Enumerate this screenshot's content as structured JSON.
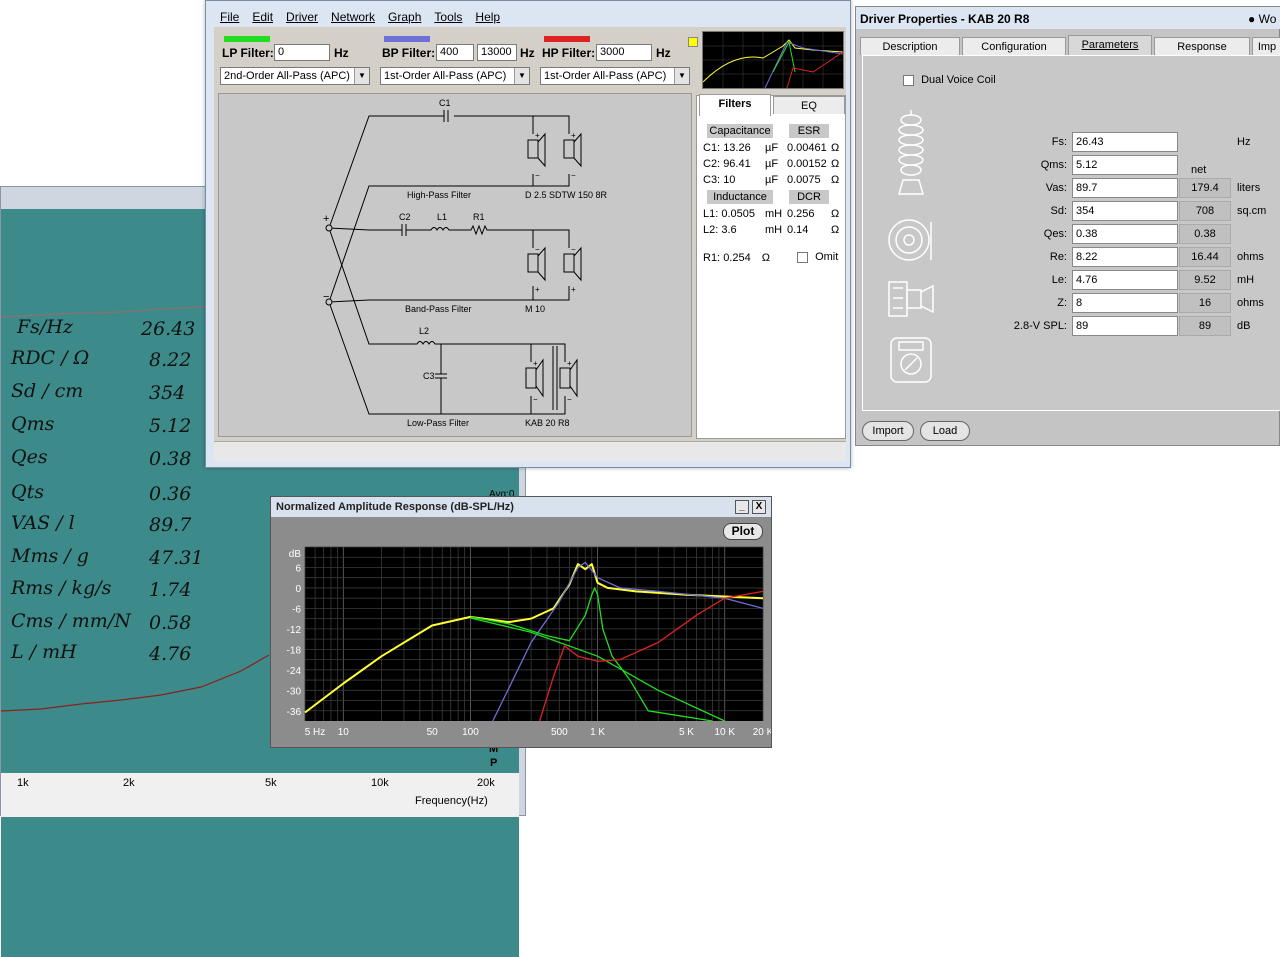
{
  "background_window": {
    "handwritten_params": [
      {
        "label": "Fs/Hz",
        "value": "26.43"
      },
      {
        "label": "RDC / Ω",
        "value": "8.22"
      },
      {
        "label": "Sd / cm",
        "value": "354"
      },
      {
        "label": "Qms",
        "value": "5.12"
      },
      {
        "label": "Qes",
        "value": "0.38"
      },
      {
        "label": "Qts",
        "value": "0.36"
      },
      {
        "label": "VAS / l",
        "value": "89.7"
      },
      {
        "label": "Mms / g",
        "value": "47.31"
      },
      {
        "label": "Rms / kg/s",
        "value": "1.74"
      },
      {
        "label": "Cms / mm/N",
        "value": "0.58"
      },
      {
        "label": "L / mH",
        "value": "4.76"
      }
    ],
    "x_ticks": [
      "1k",
      "2k",
      "5k",
      "10k",
      "20k"
    ],
    "x_axis_label": "Frequency(Hz)",
    "partial_label": "Avg:0",
    "side_letters": [
      "M",
      "P"
    ]
  },
  "crossover_window": {
    "menu": [
      "File",
      "Edit",
      "Driver",
      "Network",
      "Graph",
      "Tools",
      "Help"
    ],
    "lp": {
      "label": "LP Filter:",
      "value": "0",
      "unit": "Hz",
      "type": "2nd-Order All-Pass (APC)",
      "color": "#22dd22"
    },
    "bp": {
      "label": "BP Filter:",
      "value1": "400",
      "value2": "13000",
      "unit": "Hz",
      "type": "1st-Order All-Pass (APC)",
      "color": "#6f6fd8"
    },
    "hp": {
      "label": "HP Filter:",
      "value": "3000",
      "unit": "Hz",
      "type": "1st-Order All-Pass (APC)",
      "color": "#dd2222"
    },
    "schematic": {
      "labels": {
        "c1": "C1",
        "c2": "C2",
        "l1": "L1",
        "r1": "R1",
        "l2": "L2",
        "c3": "C3",
        "plus": "+",
        "minus": "−"
      },
      "sections": [
        {
          "filter": "High-Pass Filter",
          "driver": "D 2.5 SDTW 150 8R"
        },
        {
          "filter": "Band-Pass Filter",
          "driver": "M 10"
        },
        {
          "filter": "Low-Pass Filter",
          "driver": "KAB 20 R8"
        }
      ]
    },
    "tabs": [
      "Filters",
      "EQ"
    ],
    "capacitance_header": "Capacitance",
    "esr_header": "ESR",
    "capacitors": [
      {
        "name": "C1:",
        "value": "13.26",
        "unit": "µF",
        "esr": "0.00461",
        "esr_unit": "Ω"
      },
      {
        "name": "C2:",
        "value": "96.41",
        "unit": "µF",
        "esr": "0.00152",
        "esr_unit": "Ω"
      },
      {
        "name": "C3:",
        "value": "10",
        "unit": "µF",
        "esr": "0.0075",
        "esr_unit": "Ω"
      }
    ],
    "inductance_header": "Inductance",
    "dcr_header": "DCR",
    "inductors": [
      {
        "name": "L1:",
        "value": "0.0505",
        "unit": "mH",
        "dcr": "0.256",
        "dcr_unit": "Ω"
      },
      {
        "name": "L2:",
        "value": "3.6",
        "unit": "mH",
        "dcr": "0.14",
        "dcr_unit": "Ω"
      }
    ],
    "resistor": {
      "name": "R1:",
      "value": "0.254",
      "unit": "Ω",
      "omit_label": "Omit"
    }
  },
  "driver_window": {
    "title": "Driver Properties - KAB 20 R8",
    "radio_label": "Wo",
    "tabs": [
      "Description",
      "Configuration",
      "Parameters",
      "Response",
      "Imp"
    ],
    "active_tab": "Parameters",
    "dual_voice_coil": "Dual Voice Coil",
    "net_header": "net",
    "params": [
      {
        "label": "Fs:",
        "value": "26.43",
        "net": "",
        "unit": "Hz"
      },
      {
        "label": "Qms:",
        "value": "5.12",
        "net": "",
        "unit": ""
      },
      {
        "label": "Vas:",
        "value": "89.7",
        "net": "179.4",
        "unit": "liters"
      },
      {
        "label": "Sd:",
        "value": "354",
        "net": "708",
        "unit": "sq.cm"
      },
      {
        "label": "Qes:",
        "value": "0.38",
        "net": "0.38",
        "unit": ""
      },
      {
        "label": "Re:",
        "value": "8.22",
        "net": "16.44",
        "unit": "ohms"
      },
      {
        "label": "Le:",
        "value": "4.76",
        "net": "9.52",
        "unit": "mH"
      },
      {
        "label": "Z:",
        "value": "8",
        "net": "16",
        "unit": "ohms"
      },
      {
        "label": "2.8-V SPL:",
        "value": "89",
        "net": "89",
        "unit": "dB"
      }
    ],
    "buttons": {
      "import": "Import",
      "load": "Load"
    }
  },
  "amplitude_window": {
    "title": "Normalized Amplitude Response (dB-SPL/Hz)",
    "minimize_glyph": "_",
    "close_glyph": "X",
    "plot_button": "Plot"
  },
  "chart_data": {
    "type": "line",
    "title": "Normalized Amplitude Response (dB-SPL/Hz)",
    "xlabel": "",
    "ylabel": "dB",
    "x_scale": "log",
    "xlim": [
      5,
      20000
    ],
    "ylim": [
      -39,
      12
    ],
    "x_ticks": [
      5,
      10,
      50,
      100,
      500,
      1000,
      5000,
      10000,
      20000
    ],
    "x_tick_labels": [
      "5 Hz",
      "10",
      "50",
      "100",
      "500",
      "1 K",
      "5 K",
      "10 K",
      "20 K"
    ],
    "y_ticks": [
      6,
      0,
      -6,
      -12,
      -18,
      -24,
      -30,
      -36
    ],
    "grid": true,
    "series": [
      {
        "color": "#ffff33",
        "x": [
          5,
          10,
          20,
          50,
          100,
          200,
          300,
          450,
          600,
          700,
          800,
          900,
          1000,
          1200,
          2000,
          5000,
          20000
        ],
        "y": [
          -36.5,
          -28,
          -20,
          -11,
          -8.5,
          -10,
          -9,
          -6,
          1,
          7,
          5.5,
          7,
          1.5,
          0,
          -1,
          -2,
          -3
        ]
      },
      {
        "color": "#6f6fd8",
        "x": [
          150,
          300,
          500,
          700,
          800,
          1000,
          1500,
          3000,
          10000,
          20000
        ],
        "y": [
          -39,
          -16,
          -4,
          6,
          7.5,
          3,
          0,
          -1,
          -3,
          -6
        ]
      },
      {
        "color": "#22dd22",
        "x": [
          100,
          200,
          400,
          600,
          800,
          900,
          950,
          1000,
          1100,
          1300,
          1800,
          2500,
          8000
        ],
        "y": [
          -8.5,
          -10.5,
          -14,
          -15.5,
          -8,
          -2,
          0,
          -2,
          -12,
          -20,
          -27,
          -36,
          -39
        ]
      },
      {
        "color": "#22dd22",
        "x": [
          100,
          300,
          1000,
          3000,
          10000
        ],
        "y": [
          -8.8,
          -13,
          -20,
          -30,
          -39
        ]
      },
      {
        "color": "#dd2222",
        "x": [
          350,
          450,
          550,
          700,
          1000,
          1500,
          3000,
          6000,
          10000,
          20000
        ],
        "y": [
          -39,
          -26,
          -17,
          -20,
          -21.5,
          -21,
          -16,
          -8,
          -3,
          -1
        ]
      }
    ]
  }
}
